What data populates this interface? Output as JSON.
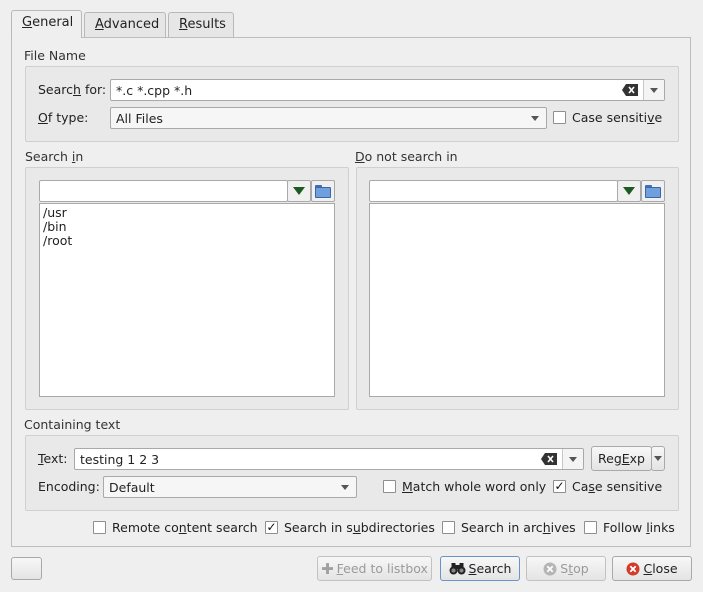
{
  "tabs": [
    {
      "label_pre": "",
      "label_u": "G",
      "label_post": "eneral"
    },
    {
      "label_pre": "",
      "label_u": "A",
      "label_post": "dvanced"
    },
    {
      "label_pre": "",
      "label_u": "R",
      "label_post": "esults"
    }
  ],
  "file_name": {
    "title": "File Name",
    "search_for_label_pre": "Searc",
    "search_for_label_u": "h",
    "search_for_label_post": " for:",
    "search_for_value": "*.c *.cpp *.h",
    "of_type_label_pre": "",
    "of_type_label_u": "O",
    "of_type_label_post": "f type:",
    "of_type_value": "All Files",
    "case_sensitive_pre": "Case sensiti",
    "case_sensitive_u": "v",
    "case_sensitive_post": "e",
    "case_sensitive_checked": false
  },
  "search_in": {
    "title_pre": "Search ",
    "title_u": "i",
    "title_post": "n",
    "input_value": "",
    "paths": [
      "/usr",
      "/bin",
      "/root"
    ]
  },
  "not_search_in": {
    "title_pre": "",
    "title_u": "D",
    "title_post": "o not search in",
    "input_value": "",
    "paths": []
  },
  "containing_text": {
    "title": "Containing text",
    "text_label_pre": "",
    "text_label_u": "T",
    "text_label_post": "ext:",
    "text_value": "testing 1 2 3",
    "regexp_pre": "Reg",
    "regexp_u": "E",
    "regexp_post": "xp",
    "encoding_label": "Encoding:",
    "encoding_value": "Default",
    "match_whole_pre": "",
    "match_whole_u": "M",
    "match_whole_post": "atch whole word only",
    "match_whole_checked": false,
    "case_sensitive_pre": "Ca",
    "case_sensitive_u": "s",
    "case_sensitive_post": "e sensitive",
    "case_sensitive_checked": true
  },
  "options": {
    "remote_pre": "Remote co",
    "remote_u": "n",
    "remote_post": "tent search",
    "remote_checked": false,
    "subdirs_pre": "Search in s",
    "subdirs_u": "u",
    "subdirs_post": "bdirectories",
    "subdirs_checked": true,
    "archives_pre": "Search in arc",
    "archives_u": "h",
    "archives_post": "ives",
    "archives_checked": false,
    "links_pre": "Follow ",
    "links_u": "l",
    "links_post": "inks",
    "links_checked": false
  },
  "buttons": {
    "feed_pre": "",
    "feed_u": "F",
    "feed_post": "eed to listbox",
    "search_pre": "",
    "search_u": "S",
    "search_post": "earch",
    "stop_pre": "S",
    "stop_u": "t",
    "stop_post": "op",
    "close_pre": "",
    "close_u": "C",
    "close_post": "lose"
  },
  "colors": {
    "accent_focus": "#6a93c8",
    "close_icon": "#d23a2a",
    "folder_blue": "#6f9fdc",
    "arrow_green": "#1e5b22"
  }
}
